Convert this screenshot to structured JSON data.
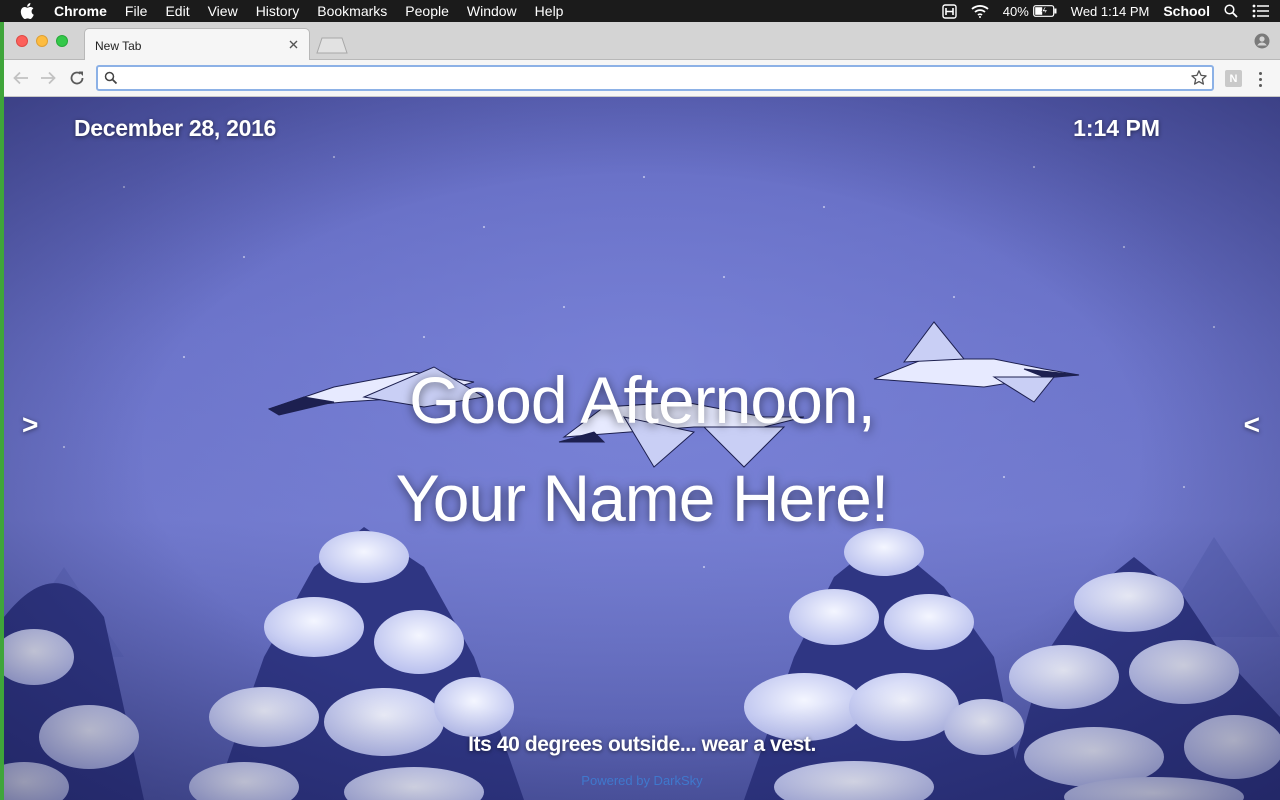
{
  "menubar": {
    "app_name": "Chrome",
    "items": [
      "File",
      "Edit",
      "View",
      "History",
      "Bookmarks",
      "People",
      "Window",
      "Help"
    ],
    "battery": "40%",
    "clock": "Wed 1:14 PM",
    "user": "School"
  },
  "browser": {
    "tab_title": "New Tab",
    "address_value": "",
    "extension_label": "N"
  },
  "page": {
    "date": "December 28, 2016",
    "time": "1:14 PM",
    "greeting_line1": "Good Afternoon,",
    "greeting_line2": "Your Name Here!",
    "next_arrow": ">",
    "prev_arrow": "<",
    "weather": "Its 40 degrees outside... wear a vest.",
    "powered_by": "Powered by DarkSky"
  },
  "colors": {
    "menubar_bg": "#1b1b1b",
    "accent_focus": "#8cb1e6",
    "background_tint": "#6a72c8",
    "powered_link": "#3d7fd6"
  },
  "icons": {
    "apple": "apple-logo-icon",
    "wifi": "wifi-icon",
    "battery": "battery-charging-icon",
    "spotlight": "spotlight-search-icon",
    "notifications": "notification-center-icon",
    "profile": "profile-icon",
    "bookmark": "star-icon"
  }
}
